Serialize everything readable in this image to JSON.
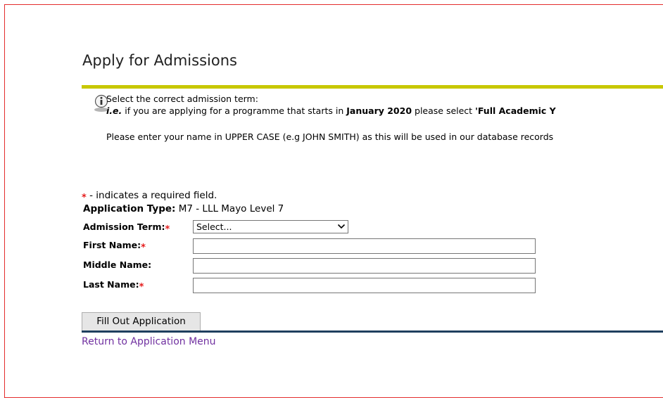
{
  "page": {
    "title": "Apply for Admissions"
  },
  "info": {
    "line1": "Select the correct admission term:",
    "line2_prefix": "i.e.",
    "line2_a": " if you are applying for a programme that starts in ",
    "line2_b": "January 2020",
    "line2_c": " please select ",
    "line2_d": "'Full Academic Y",
    "line3": "Please enter your name in UPPER CASE (e.g JOHN SMITH) as this will be used in our database records"
  },
  "form": {
    "required_marker": "*",
    "required_note": " - indicates a required field.",
    "application_type_label": "Application Type:",
    "application_type_value": " M7 - LLL Mayo Level 7",
    "admission_term_label": "Admission Term:",
    "admission_term_value": "Select...",
    "first_name_label": "First Name:",
    "middle_name_label": "Middle Name:",
    "last_name_label": "Last Name:",
    "first_name_value": "",
    "middle_name_value": "",
    "last_name_value": "",
    "submit_label": "Fill Out Application",
    "return_link": "Return to Application Menu"
  },
  "colors": {
    "title_rule": "#c8c800",
    "bottom_rule": "#1f3f5f",
    "required_star": "#e51c1c",
    "link": "#7030a0",
    "frame_border": "#e32c2c"
  },
  "icons": {
    "info": "info-icon",
    "dropdown": "chevron-down-icon",
    "required": "asterisk-icon"
  }
}
